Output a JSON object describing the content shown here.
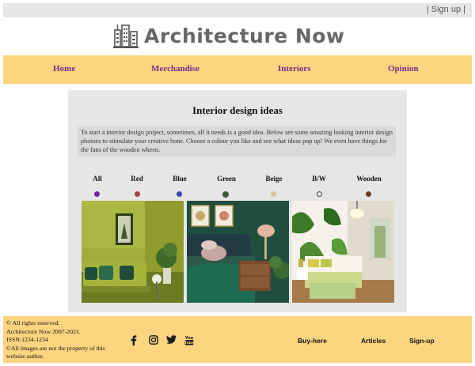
{
  "header": {
    "signup": "| Sign up |",
    "logo_text": "Architecture Now"
  },
  "nav": {
    "home": "Home",
    "merchandise": "Merchandise",
    "interiors": "Interiors",
    "opinion": "Opinion"
  },
  "main": {
    "title": "Interior design ideas",
    "intro": "To start a interior design project, sometimes, all it needs is a good idea. Below are some amazing looking interior design photoes to stimulate your creative bone. Choose a colour you like and see what ideas pop up! We even have things for the fans of the wooden wheen.",
    "filters": [
      {
        "label": "All",
        "color": "#7a1fa0"
      },
      {
        "label": "Red",
        "color": "#a8403a"
      },
      {
        "label": "Blue",
        "color": "#3d4aa8"
      },
      {
        "label": "Green",
        "color": "#3d5a3a"
      },
      {
        "label": "Beige",
        "color": "#d6c79a"
      },
      {
        "label": "B/W",
        "color": "#333333"
      },
      {
        "label": "Wooden",
        "color": "#6b3a26"
      }
    ]
  },
  "footer": {
    "copy1": "© All rights reserved.",
    "copy2": "Architecture Now 2007-2021.",
    "copy3": "ISSN:1234-1234",
    "copy4": "©All images are not the property of this",
    "copy5": "website author.",
    "buy": "Buy-here",
    "articles": "Articles",
    "signup": "Sign-up"
  }
}
